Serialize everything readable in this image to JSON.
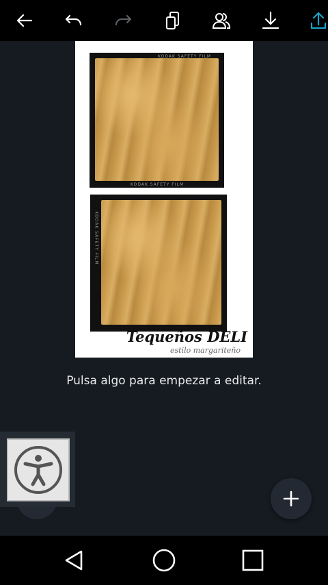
{
  "toolbar": {
    "icons": [
      "back-arrow-icon",
      "undo-icon",
      "redo-icon",
      "copy-icon",
      "collaborators-icon",
      "download-icon",
      "share-upload-icon"
    ],
    "accent_color": "#1aa1c7"
  },
  "canvas": {
    "photo1_film_top": "KODAK SAFETY FILM",
    "photo1_film_bottom": "KODAK SAFETY FILM",
    "photo2_film_side": "KODAK SAFETY FILM",
    "brand_title": "Tequeños DELI",
    "brand_subtitle": "estilo margariteño"
  },
  "main": {
    "hint_text": "Pulsa algo para empezar a editar."
  },
  "colors": {
    "background": "#161b21",
    "toolbar": "#000000"
  }
}
